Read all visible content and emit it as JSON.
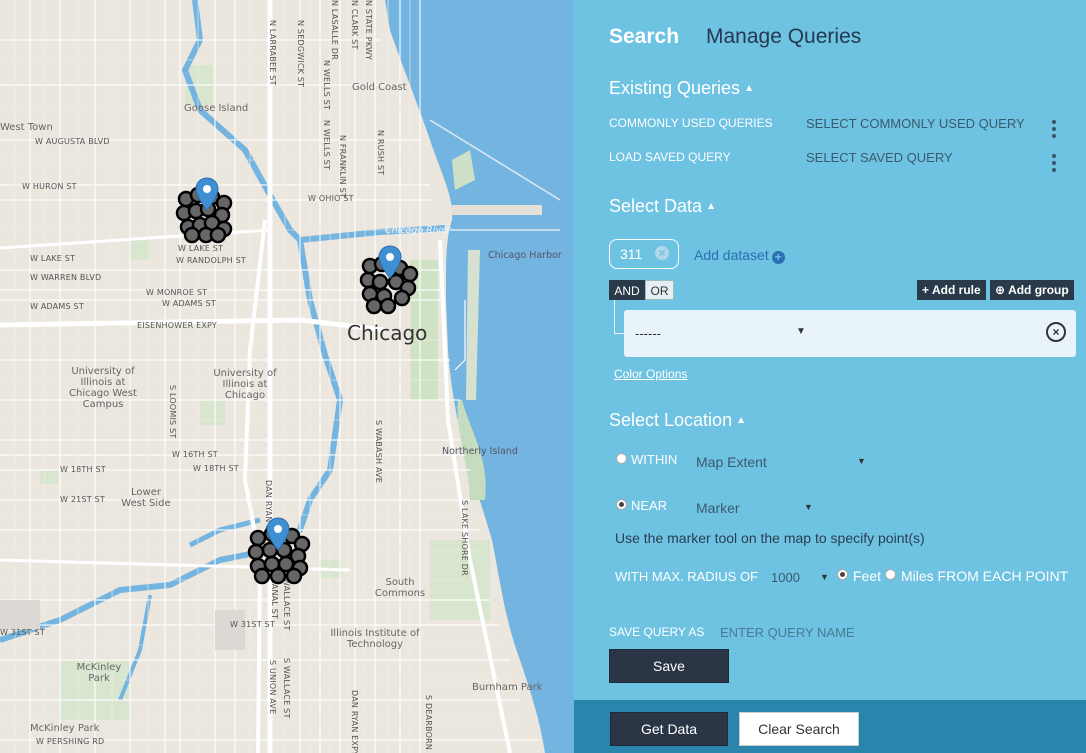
{
  "map": {
    "labels": {
      "goose_island": "Goose Island",
      "gold_coast": "Gold Coast",
      "west_town": "West Town",
      "chicago": "Chicago",
      "chicago_river": "Chicago River",
      "chicago_harbor": "Chicago Harbor",
      "northerly_island": "Northerly Island",
      "uic": "University of Illinois at Chicago West Campus",
      "uic2": "University of Illinois at Chicago",
      "lower_west_side": "Lower West Side",
      "south_commons": "South Commons",
      "iit": "Illinois Institute of Technology",
      "burnham_park": "Burnham Park",
      "mckinley_park": "McKinley Park",
      "mckinley_park2": "McKinley Park",
      "augusta": "W AUGUSTA BLVD",
      "huron": "W HURON ST",
      "ohio": "W OHIO ST",
      "lake": "W LAKE ST",
      "randolph": "W RANDOLPH ST",
      "lake2": "W LAKE ST",
      "warren": "W WARREN BLVD",
      "monroe": "W MONROE ST",
      "adams": "W ADAMS ST",
      "adams2": "W ADAMS ST",
      "eisenhower": "EISENHOWER EXPY",
      "sixteenth": "W 16TH ST",
      "eighteenth": "W 18TH ST",
      "eighteenth2": "W 18TH ST",
      "twentyfirst": "W 21ST ST",
      "thirtyfirst": "W 31ST ST",
      "thirtyfirst2": "W 31ST ST",
      "pershing": "W PERSHING RD",
      "larrabee": "N LARRABEE ST",
      "sedgwick": "N SEDGWICK ST",
      "wells": "N WELLS ST",
      "wells2": "N WELLS ST",
      "clark": "N CLARK ST",
      "lasalle": "N LASALLE DR",
      "franklin": "N FRANKLIN ST",
      "rush": "N RUSH ST",
      "state": "N STATE PKWY",
      "wabash": "S WABASH AVE",
      "loomis": "S LOOMIS ST",
      "lakeshore": "S LAKE SHORE DR",
      "wallace": "S WALLACE ST",
      "wallace2": "S WALLACE ST",
      "danryan": "DAN RYAN EXPY",
      "danryan2": "DAN RYAN EXPY",
      "union": "S UNION AVE",
      "canal": "S CANAL ST",
      "dearborn": "S DEARBORN ST"
    }
  },
  "tabs": {
    "search": "Search",
    "manage": "Manage Queries"
  },
  "existing": {
    "title": "Existing Queries",
    "common_label": "COMMONLY USED QUERIES",
    "common_value": "SELECT COMMONLY USED QUERY",
    "saved_label": "LOAD SAVED QUERY",
    "saved_value": "SELECT SAVED QUERY"
  },
  "select_data": {
    "title": "Select Data",
    "dataset_chip": "311",
    "add_dataset": "Add dataset",
    "and": "AND",
    "or": "OR",
    "add_rule": "Add rule",
    "add_group": "Add group",
    "rule_value": "------",
    "color_options": "Color Options"
  },
  "location": {
    "title": "Select Location",
    "within_label": "WITHIN",
    "within_value": "Map Extent",
    "near_label": "NEAR",
    "near_value": "Marker",
    "hint": "Use the marker tool on the map to specify point(s)",
    "radius_label": "WITH MAX. RADIUS OF",
    "radius_value": "1000",
    "feet": "Feet",
    "miles": "Miles FROM EACH POINT"
  },
  "save": {
    "label": "SAVE QUERY AS",
    "placeholder": "ENTER QUERY NAME",
    "button": "Save"
  },
  "footer": {
    "get_data": "Get Data",
    "clear": "Clear Search"
  },
  "colors": {
    "panel": "#6ec2e2",
    "water": "#74b4e0",
    "dark_button": "#2a3646",
    "footer": "#2a85ad"
  },
  "icons": [
    "caret-up-icon",
    "kebab-icon",
    "close-circle-icon",
    "plus-circle-icon",
    "plus-icon",
    "map-marker-icon"
  ]
}
